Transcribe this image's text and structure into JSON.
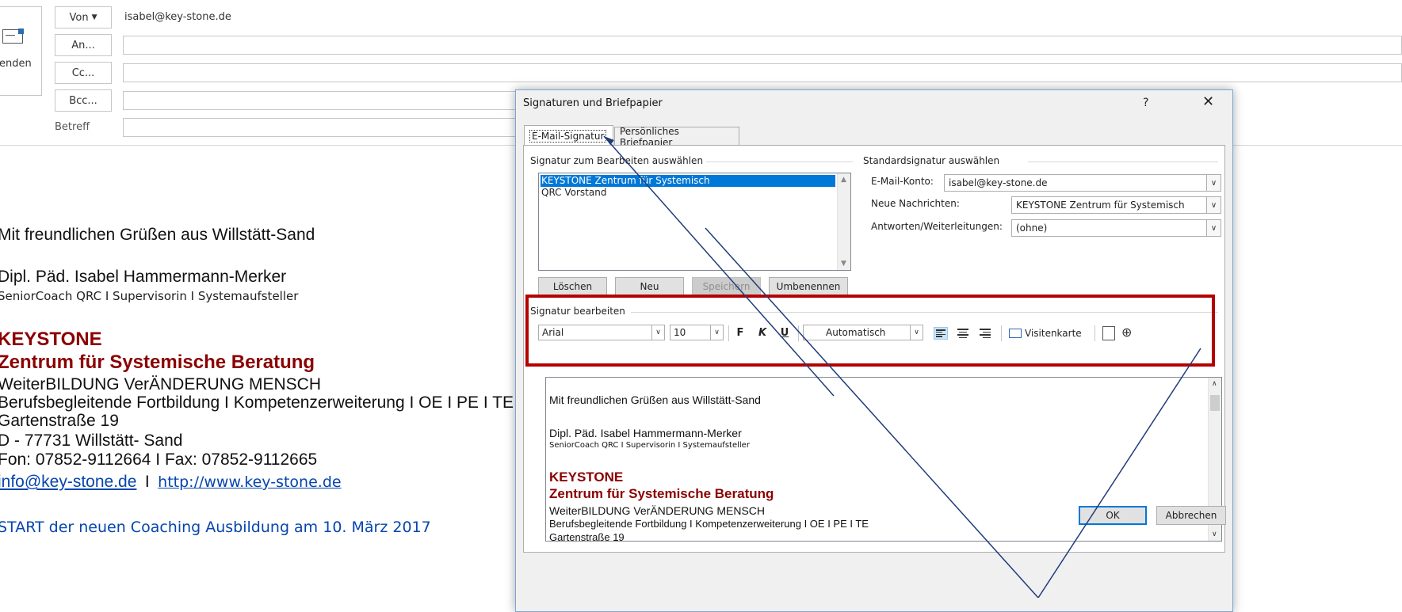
{
  "compose": {
    "send_label": "enden",
    "from_button": "Von",
    "from_value": "isabel@key-stone.de",
    "to_button": "An...",
    "cc_button": "Cc...",
    "bcc_button": "Bcc...",
    "subject_label": "Betreff"
  },
  "body": {
    "greeting": "Mit freundlichen Grüßen aus Willstätt-Sand",
    "name": "Dipl. Päd. Isabel Hammermann-Merker",
    "roles": "SeniorCoach QRC I Supervisorin I Systemaufsteller",
    "org1": "KEYSTONE",
    "org2": "Zentrum für Systemische Beratung",
    "line1": "WeiterBILDUNG VerÄNDERUNG MENSCH",
    "line2": "Berufsbegleitende Fortbildung I Kompetenzerweiterung I OE I PE I TE",
    "street": "Gartenstraße 19",
    "city": "D - 77731 Willstätt- Sand",
    "phone": "Fon: 07852-9112664 I Fax: 07852-9112665",
    "email_link": "info@key-stone.de",
    "separator": "I",
    "web_link": "http://www.key-stone.de",
    "promo": "START der neuen Coaching Ausbildung am 10. März 2017"
  },
  "dialog": {
    "title": "Signaturen und Briefpapier",
    "help": "?",
    "close": "✕",
    "tabs": [
      {
        "label": "E-Mail-Signatur",
        "active": true
      },
      {
        "label": "Persönliches Briefpapier",
        "active": false
      }
    ],
    "select_group_title": "Signatur zum Bearbeiten auswählen",
    "signatures": [
      {
        "label": "KEYSTONE Zentrum für Systemisch",
        "selected": true
      },
      {
        "label": "QRC Vorstand",
        "selected": false
      }
    ],
    "buttons": {
      "delete": "Löschen",
      "new": "Neu",
      "save": "Speichern",
      "rename": "Umbenennen"
    },
    "default_group_title": "Standardsignatur auswählen",
    "account_label": "E-Mail-Konto:",
    "account_value": "isabel@key-stone.de",
    "new_messages_label": "Neue Nachrichten:",
    "new_messages_value": "KEYSTONE Zentrum für Systemisch",
    "replies_label": "Antworten/Weiterleitungen:",
    "replies_value": "(ohne)",
    "edit_group_title": "Signatur bearbeiten",
    "toolbar": {
      "font": "Arial",
      "size": "10",
      "bold": "F",
      "italic": "K",
      "underline": "U",
      "color": "Automatisch",
      "vcard": "Visitenkarte"
    },
    "editor": {
      "greeting": "Mit freundlichen Grüßen aus Willstätt-Sand",
      "name": "Dipl. Päd. Isabel Hammermann-Merker",
      "roles": "SeniorCoach QRC I Supervisorin I Systemaufsteller",
      "org1": "KEYSTONE",
      "org2": "Zentrum für Systemische Beratung",
      "line1": "WeiterBILDUNG VerÄNDERUNG MENSCH",
      "line2": "Berufsbegleitende Fortbildung I Kompetenzerweiterung I OE I PE I TE",
      "street": "Gartenstraße 19"
    },
    "ok": "OK",
    "cancel": "Abbrechen"
  },
  "colors": {
    "highlight_box": "#b40000",
    "org_red": "#8b0000",
    "selection": "#0078d7",
    "link": "#0645ad"
  }
}
